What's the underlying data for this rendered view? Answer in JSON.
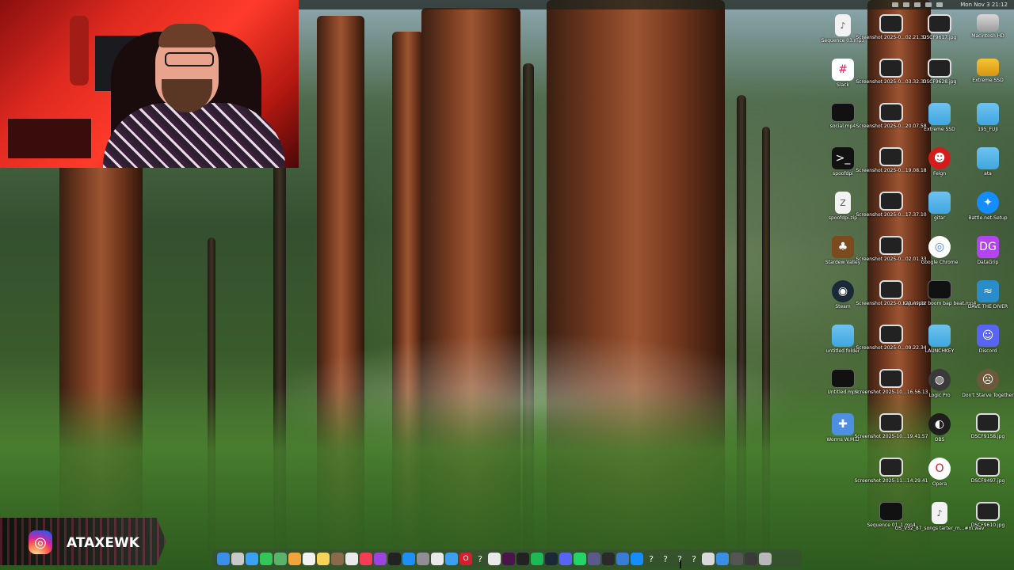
{
  "menubar": {
    "clock": "Mon Nov 3  21:12"
  },
  "overlay": {
    "instagram_handle": "ATAXEWK",
    "instagram_icon": "instagram-icon"
  },
  "desktop_icons": [
    {
      "label": "Sequence 03.mp3",
      "type": "file",
      "icon": "music-file-icon"
    },
    {
      "label": "Slack",
      "type": "app",
      "icon": "slack-icon"
    },
    {
      "label": "social.mp4",
      "type": "video",
      "icon": "video-file-icon"
    },
    {
      "label": "spoofdpi",
      "type": "exec",
      "icon": "terminal-exec-icon"
    },
    {
      "label": "spoofdpi.zip",
      "type": "file",
      "icon": "zip-file-icon"
    },
    {
      "label": "Stardew Valley",
      "type": "app",
      "icon": "stardew-icon"
    },
    {
      "label": "Steam",
      "type": "app",
      "icon": "steam-icon"
    },
    {
      "label": "untitled folder",
      "type": "folder",
      "icon": "folder-icon"
    },
    {
      "label": "Untitled.mp4",
      "type": "video",
      "icon": "video-file-icon"
    },
    {
      "label": "Worms W.M.D",
      "type": "app",
      "icon": "worms-icon"
    },
    {
      "label": "Screenshot 2025-0...02.21.32",
      "type": "shot",
      "icon": "screenshot-icon"
    },
    {
      "label": "Screenshot 2025-0...03.32.35",
      "type": "shot",
      "icon": "screenshot-icon"
    },
    {
      "label": "Screenshot 2025-0...20.07.58",
      "type": "shot",
      "icon": "screenshot-icon"
    },
    {
      "label": "Screenshot 2025-0...19.08.18",
      "type": "shot",
      "icon": "screenshot-icon"
    },
    {
      "label": "Screenshot 2025-0...17.37.10",
      "type": "shot",
      "icon": "screenshot-icon"
    },
    {
      "label": "Screenshot 2025-0...02.01.33",
      "type": "shot",
      "icon": "screenshot-icon"
    },
    {
      "label": "Screenshot 2025-0...22.49.32",
      "type": "shot",
      "icon": "screenshot-icon"
    },
    {
      "label": "Screenshot 2025-0...09.22.34",
      "type": "shot",
      "icon": "screenshot-icon"
    },
    {
      "label": "Screenshot 2025-10...16.56.13",
      "type": "shot",
      "icon": "screenshot-icon"
    },
    {
      "label": "Screenshot 2025-10...19.41.57",
      "type": "shot",
      "icon": "screenshot-icon"
    },
    {
      "label": "Screenshot 2025-11...14.29.41",
      "type": "shot",
      "icon": "screenshot-icon"
    },
    {
      "label": "Sequence 01_1.mp4",
      "type": "video",
      "icon": "video-file-icon"
    },
    {
      "label": "DSCF9617.jpg",
      "type": "shot",
      "icon": "image-file-icon"
    },
    {
      "label": "DSCF9628.jpg",
      "type": "shot",
      "icon": "image-file-icon"
    },
    {
      "label": "Extreme SSD",
      "type": "folder",
      "icon": "folder-icon"
    },
    {
      "label": "Feign",
      "type": "app",
      "icon": "feign-icon"
    },
    {
      "label": "gitar",
      "type": "folder",
      "icon": "folder-icon"
    },
    {
      "label": "Google Chrome",
      "type": "app",
      "icon": "chrome-icon"
    },
    {
      "label": "Kajunspor boom bap beat.mp4",
      "type": "video",
      "icon": "video-file-icon"
    },
    {
      "label": "LAUNCHKEY",
      "type": "folder",
      "icon": "folder-icon"
    },
    {
      "label": "Logic Pro",
      "type": "app",
      "icon": "logic-pro-icon"
    },
    {
      "label": "OBS",
      "type": "app",
      "icon": "obs-icon"
    },
    {
      "label": "Opera",
      "type": "app",
      "icon": "opera-icon"
    },
    {
      "label": "OS_V52_87_songs tarter_m...#m.wav",
      "type": "file",
      "icon": "audio-file-icon"
    },
    {
      "label": "Macintosh HD",
      "type": "drive",
      "icon": "hard-drive-icon"
    },
    {
      "label": "Extreme SSD",
      "type": "ydrive",
      "icon": "external-drive-icon"
    },
    {
      "label": "195_FUJI",
      "type": "folder",
      "icon": "folder-icon"
    },
    {
      "label": "ata",
      "type": "folder",
      "icon": "folder-icon"
    },
    {
      "label": "Battle.net-Setup",
      "type": "app",
      "icon": "battlenet-icon"
    },
    {
      "label": "DataGrip",
      "type": "app",
      "icon": "datagrip-icon"
    },
    {
      "label": "DAVE THE DIVER",
      "type": "app",
      "icon": "dave-diver-icon"
    },
    {
      "label": "Discord",
      "type": "app",
      "icon": "discord-icon"
    },
    {
      "label": "Don't Starve Together",
      "type": "app",
      "icon": "dont-starve-icon"
    },
    {
      "label": "DSCF9158.jpg",
      "type": "shot",
      "icon": "image-file-icon"
    },
    {
      "label": "DSCF9497.jpg",
      "type": "shot",
      "icon": "image-file-icon"
    },
    {
      "label": "DSCF9610.jpg",
      "type": "shot",
      "icon": "image-file-icon"
    }
  ],
  "icon_glyphs": {
    "slack-icon": "#",
    "steam-icon": "◉",
    "chrome-icon": "◎",
    "opera-icon": "O",
    "discord-icon": "☺",
    "battlenet-icon": "✦",
    "datagrip-icon": "DG",
    "logic-pro-icon": "◍",
    "obs-icon": "◐",
    "feign-icon": "☻",
    "stardew-icon": "♣",
    "worms-icon": "✚",
    "dave-diver-icon": "≈",
    "dont-starve-icon": "☹",
    "music-file-icon": "♪",
    "audio-file-icon": "♪",
    "zip-file-icon": "Z",
    "terminal-exec-icon": ">_"
  },
  "icon_colors": {
    "slack-icon": "#ffffff",
    "steam-icon": "#1b2838",
    "chrome-icon": "#ffffff",
    "opera-icon": "#ffffff",
    "discord-icon": "#5865f2",
    "battlenet-icon": "#148eff",
    "datagrip-icon": "#b345f1",
    "logic-pro-icon": "#3a3a3a",
    "obs-icon": "#1e1e1e",
    "feign-icon": "#d51c1c",
    "stardew-icon": "#7b4a1f",
    "worms-icon": "#4f8fe0",
    "dave-diver-icon": "#2a8cc9",
    "dont-starve-icon": "#6b5a3a",
    "terminal-exec-icon": "#111111"
  },
  "dock": [
    "finder-icon",
    "launchpad-icon",
    "mail-icon",
    "messages-icon",
    "maps-icon",
    "photos-icon",
    "calendar-icon",
    "notes-icon",
    "finder2-icon",
    "notes-icon2",
    "music-icon",
    "podcasts-icon",
    "tv-icon",
    "app-store-icon",
    "settings-icon",
    "chrome-icon",
    "safari-icon",
    "opera-icon",
    "help-icon",
    "chrome2-icon",
    "slack-icon",
    "terminal-icon",
    "spotify-icon",
    "steam-icon",
    "discord-icon",
    "whatsapp-icon",
    "search-icon",
    "obs-icon",
    "launch-arrow-icon",
    "battlenet-icon",
    "help-icon2",
    "help-icon3",
    "help-icon4",
    "help-icon5",
    "preview-icon",
    "downloads-icon",
    "recent-icon",
    "stacks-icon",
    "trash-icon"
  ],
  "dock_glyphs": {
    "help-icon": "?",
    "help-icon2": "?",
    "help-icon3": "?",
    "help-icon4": "?",
    "help-icon5": "?",
    "opera-icon": "O"
  },
  "dock_colors": {
    "finder-icon": "#3b8fe8",
    "launchpad-icon": "#c9c9c9",
    "mail-icon": "#3ba1f5",
    "messages-icon": "#33c759",
    "maps-icon": "#59b36b",
    "photos-icon": "#f0a43c",
    "calendar-icon": "#f2f2f2",
    "notes-icon": "#f6d45a",
    "finder2-icon": "#8a6a4a",
    "notes-icon2": "#e9e9e9",
    "music-icon": "#f33d54",
    "podcasts-icon": "#9b44e0",
    "tv-icon": "#222222",
    "app-store-icon": "#1e90f5",
    "settings-icon": "#8e8e93",
    "chrome-icon": "#e9e9e9",
    "safari-icon": "#3ca0f0",
    "opera-icon": "#d2202f",
    "chrome2-icon": "#e9e9e9",
    "slack-icon": "#4a154b",
    "terminal-icon": "#222222",
    "spotify-icon": "#1db954",
    "steam-icon": "#1b2838",
    "discord-icon": "#5865f2",
    "whatsapp-icon": "#25d366",
    "search-icon": "#5a5a8a",
    "obs-icon": "#2a2a2a",
    "launch-arrow-icon": "#3a7bd5",
    "battlenet-icon": "#148eff",
    "preview-icon": "#d9d9d9",
    "downloads-icon": "#3a8ee6",
    "recent-icon": "#555555",
    "stacks-icon": "#3a3a3a",
    "trash-icon": "#b8b8b8"
  }
}
